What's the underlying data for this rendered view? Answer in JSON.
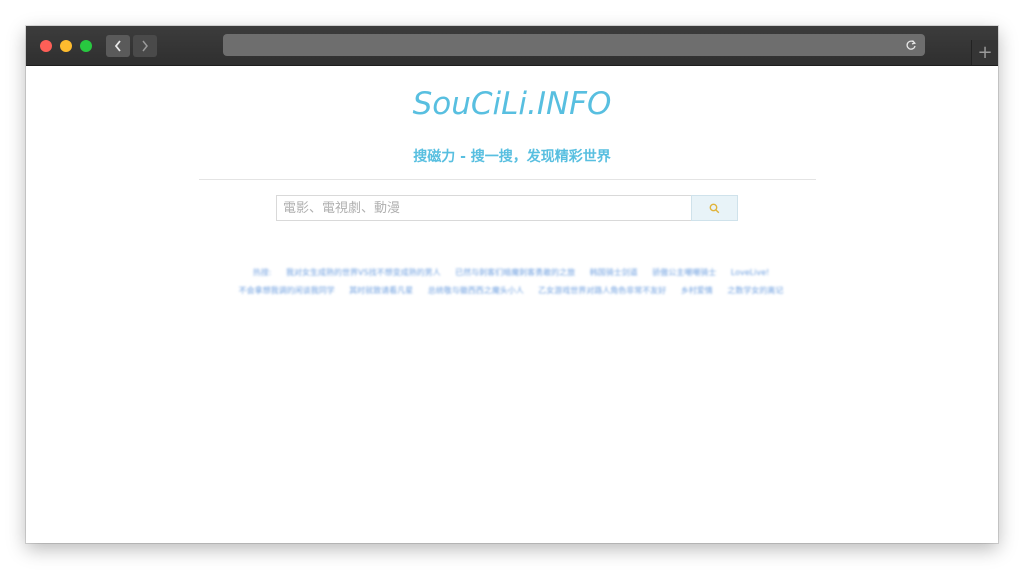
{
  "browser": {
    "title_bar_color": "#2f2f2f",
    "traffic_lights": [
      "#fe5f57",
      "#febc2e",
      "#28c840"
    ],
    "icons": {
      "back": "chevron-left-icon",
      "forward": "chevron-right-icon",
      "reload": "reload-icon",
      "new_tab": "plus-icon"
    },
    "new_tab_label": "+"
  },
  "page": {
    "logo": "SouCiLi.INFO",
    "tagline": "搜磁力 - 搜一搜，发现精彩世界",
    "accent_color": "#58bfe0",
    "search": {
      "placeholder": "電影、電視劇、動漫",
      "value": "",
      "button_icon": "search-icon"
    },
    "hot": {
      "label": "热搜:",
      "items": [
        "我对女生成熟的世界VS找不想变成熟的男人",
        "已然与刺客们暗魔刺客勇敢的之旅",
        "韩国骑士剑道",
        "骄傲公主嘲嘲骑士",
        "LoveLive!",
        "不会拿想我调的闲谈我同学",
        "其时就致请看凡星",
        "总统敬与徽西西之魔头小人",
        "乙女游戏世界对路人角色非常不友好",
        "乡村爱情",
        "之数学女的离记"
      ]
    }
  }
}
